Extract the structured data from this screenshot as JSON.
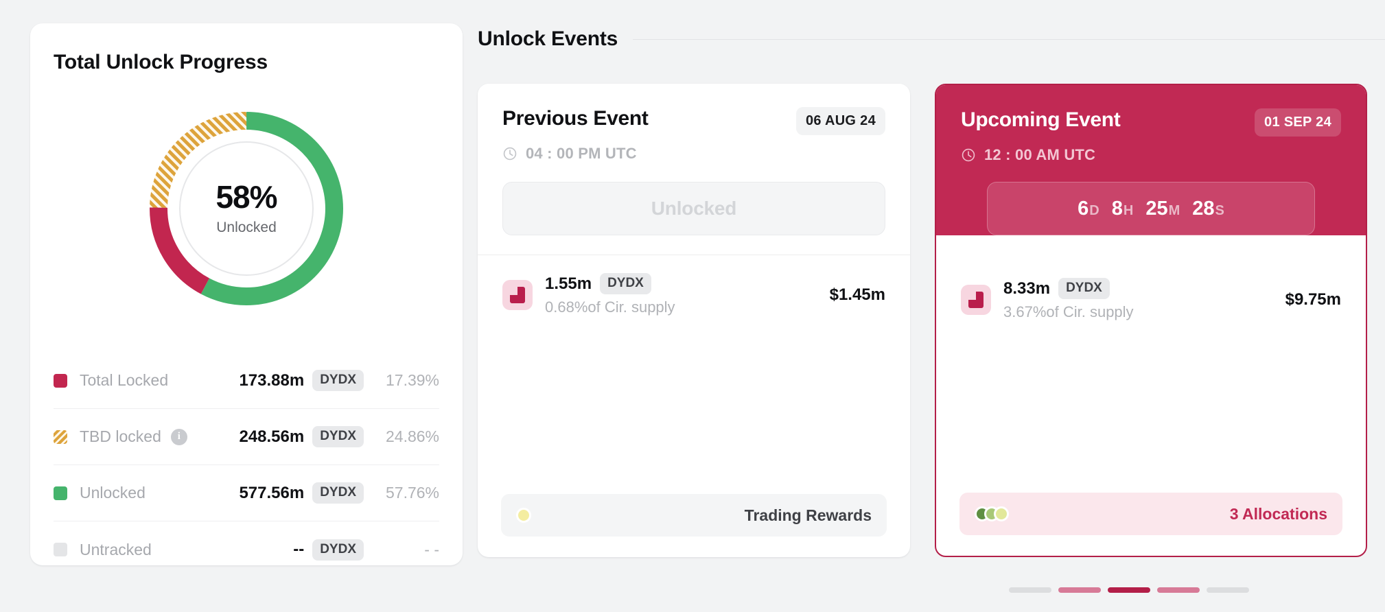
{
  "colors": {
    "locked": "#c2264f",
    "tbd": "#dda33b",
    "unlocked": "#45b46c",
    "untracked": "#e4e5e7",
    "accent": "#c12954",
    "track": "#e6e7e9"
  },
  "progress_card": {
    "title": "Total Unlock Progress",
    "donut": {
      "percent_label": "58%",
      "sub_label": "Unlocked"
    },
    "legend": [
      {
        "swatch": "solid-crimson",
        "label": "Total Locked",
        "has_info": false,
        "value": "173.88m",
        "ticker": "DYDX",
        "percent": "17.39%"
      },
      {
        "swatch": "striped-gold",
        "label": "TBD locked",
        "has_info": true,
        "value": "248.56m",
        "ticker": "DYDX",
        "percent": "24.86%"
      },
      {
        "swatch": "solid-green",
        "label": "Unlocked",
        "has_info": false,
        "value": "577.56m",
        "ticker": "DYDX",
        "percent": "57.76%"
      },
      {
        "swatch": "solid-grey",
        "label": "Untracked",
        "has_info": false,
        "value": "--",
        "ticker": "DYDX",
        "percent": "- -"
      }
    ]
  },
  "events": {
    "section_title": "Unlock Events",
    "previous": {
      "name": "Previous Event",
      "date_badge": "06 AUG 24",
      "time": "04 : 00 PM UTC",
      "status_label": "Unlocked",
      "allocation": {
        "amount": "1.55m",
        "ticker": "DYDX",
        "supply_note": "0.68%of Cir. supply",
        "usd_value": "$1.45m"
      },
      "footer_label": "Trading Rewards",
      "footer_dots": [
        "#f4eda0"
      ]
    },
    "upcoming": {
      "name": "Upcoming Event",
      "date_badge": "01 SEP 24",
      "time": "12 : 00 AM UTC",
      "countdown": [
        {
          "value": "6",
          "unit": "D"
        },
        {
          "value": "8",
          "unit": "H"
        },
        {
          "value": "25",
          "unit": "M"
        },
        {
          "value": "28",
          "unit": "S"
        }
      ],
      "allocation": {
        "amount": "8.33m",
        "ticker": "DYDX",
        "supply_note": "3.67%of Cir. supply",
        "usd_value": "$9.75m"
      },
      "footer_label": "3 Allocations",
      "footer_dots": [
        "#5f8f42",
        "#a8c877",
        "#e2e89a"
      ]
    }
  },
  "pagination": {
    "bars": [
      "#dcdddf",
      "#d77a97",
      "#b31e48",
      "#d77a97",
      "#dcdddf"
    ]
  },
  "chart_data": {
    "type": "pie",
    "title": "Total Unlock Progress",
    "center_label": "58%",
    "center_sublabel": "Unlocked",
    "categories": [
      "Total Locked",
      "TBD locked",
      "Unlocked",
      "Untracked"
    ],
    "values": [
      17.39,
      24.86,
      57.76,
      0
    ],
    "value_labels": [
      "173.88m DYDX",
      "248.56m DYDX",
      "577.56m DYDX",
      "-- DYDX"
    ],
    "percent_labels": [
      "17.39%",
      "24.86%",
      "57.76%",
      "- -"
    ],
    "colors": [
      "#c2264f",
      "#dda33b",
      "#45b46c",
      "#e4e5e7"
    ],
    "legend_position": "bottom",
    "donut": true
  }
}
